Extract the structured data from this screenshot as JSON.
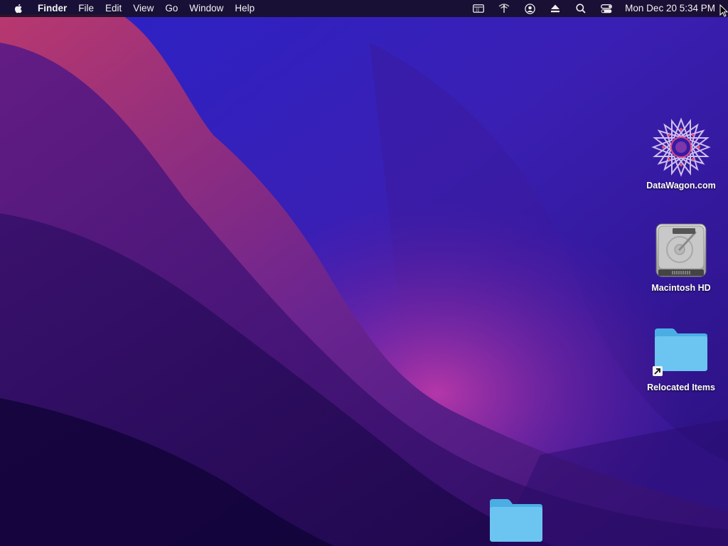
{
  "menubar": {
    "apple_icon": "apple-logo-icon",
    "app_name": "Finder",
    "menus": [
      "File",
      "Edit",
      "View",
      "Go",
      "Window",
      "Help"
    ],
    "status_icons": [
      "keyboard-input-icon",
      "wifi-icon",
      "user-account-icon",
      "eject-icon",
      "spotlight-search-icon",
      "control-center-icon"
    ],
    "clock": "Mon Dec 20  5:34 PM"
  },
  "desktop": {
    "icons": [
      {
        "label": "DataWagon.com",
        "icon": "datawagon-star-icon"
      },
      {
        "label": "Macintosh HD",
        "icon": "hard-drive-icon"
      },
      {
        "label": "Relocated Items",
        "icon": "folder-alias-icon"
      },
      {
        "label": "",
        "icon": "folder-icon"
      }
    ]
  },
  "colors": {
    "menubar_bg": "#160e22",
    "folder_blue": "#6cc4f0",
    "wallpaper_purple": "#3a1d8a",
    "wallpaper_magenta": "#9a2a9e"
  }
}
